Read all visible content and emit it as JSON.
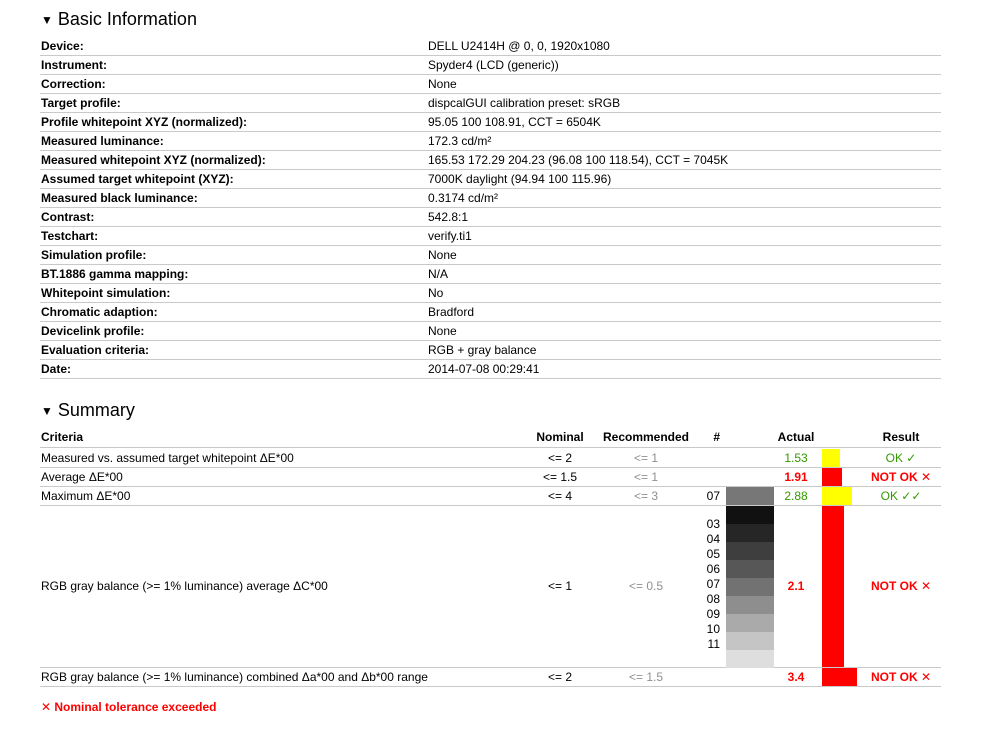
{
  "basic_info": {
    "heading": "Basic Information",
    "rows": [
      {
        "label": "Device:",
        "value": "DELL U2414H @ 0, 0, 1920x1080"
      },
      {
        "label": "Instrument:",
        "value": "Spyder4 (LCD (generic))"
      },
      {
        "label": "Correction:",
        "value": "None"
      },
      {
        "label": "Target profile:",
        "value": "dispcalGUI calibration preset: sRGB"
      },
      {
        "label": "Profile whitepoint XYZ (normalized):",
        "value": "95.05 100 108.91, CCT = 6504K"
      },
      {
        "label": "Measured luminance:",
        "value": "172.3 cd/m²"
      },
      {
        "label": "Measured whitepoint XYZ (normalized):",
        "value": "165.53 172.29 204.23 (96.08 100 118.54), CCT = 7045K"
      },
      {
        "label": "Assumed target whitepoint (XYZ):",
        "value": "7000K daylight (94.94 100 115.96)"
      },
      {
        "label": "Measured black luminance:",
        "value": "0.3174 cd/m²"
      },
      {
        "label": "Contrast:",
        "value": "542.8:1"
      },
      {
        "label": "Testchart:",
        "value": "verify.ti1"
      },
      {
        "label": "Simulation profile:",
        "value": "None"
      },
      {
        "label": "BT.1886 gamma mapping:",
        "value": "N/A"
      },
      {
        "label": "Whitepoint simulation:",
        "value": "No"
      },
      {
        "label": "Chromatic adaption:",
        "value": "Bradford"
      },
      {
        "label": "Devicelink profile:",
        "value": "None"
      },
      {
        "label": "Evaluation criteria:",
        "value": "RGB + gray balance"
      },
      {
        "label": "Date:",
        "value": "2014-07-08 00:29:41"
      }
    ]
  },
  "summary": {
    "heading": "Summary",
    "headers": {
      "criteria": "Criteria",
      "nominal": "Nominal",
      "recommended": "Recommended",
      "number": "#",
      "actual": "Actual",
      "result": "Result"
    },
    "rows": [
      {
        "criteria": "Measured vs. assumed target whitepoint ΔE*00",
        "nominal": "<= 2",
        "recommended": "<= 1",
        "number": "",
        "actual": "1.53",
        "result": "OK ✓",
        "bar_color": "#ffff00",
        "bar_fraction": 0.25
      },
      {
        "criteria": "Average ΔE*00",
        "nominal": "<= 1.5",
        "recommended": "<= 1",
        "number": "",
        "actual": "1.91",
        "result": "NOT OK ✕",
        "bar_color": "#ff0000",
        "bar_fraction": 0.28
      },
      {
        "criteria": "Maximum ΔE*00",
        "nominal": "<= 4",
        "recommended": "<= 3",
        "number": "07",
        "actual": "2.88",
        "result": "OK ✓✓",
        "bar_color": "#ffff00",
        "bar_fraction": 0.42
      },
      {
        "criteria": "RGB gray balance (>= 1% luminance) average ΔC*00",
        "nominal": "<= 1",
        "recommended": "<= 0.5",
        "numbers": [
          "03",
          "04",
          "05",
          "06",
          "07",
          "08",
          "09",
          "10",
          "11"
        ],
        "actual": "2.1",
        "result": "NOT OK ✕",
        "bar_color": "#ff0000",
        "bar_fraction": 0.3
      },
      {
        "criteria": "RGB gray balance (>= 1% luminance) combined Δa*00 and Δb*00 range",
        "nominal": "<= 2",
        "recommended": "<= 1.5",
        "number": "",
        "actual": "3.4",
        "result": "NOT OK ✕",
        "bar_color": "#ff0000",
        "bar_fraction": 0.48
      }
    ],
    "gray_swatches": [
      "#111111",
      "#262626",
      "#3e3e3e",
      "#575757",
      "#727272",
      "#8e8e8e",
      "#aaaaaa",
      "#c5c5c5",
      "#dedede"
    ],
    "max_swatch": "#777777",
    "footer": "✕ Nominal tolerance exceeded"
  },
  "colors": {
    "ok": "#339900",
    "bad": "#ff0000",
    "warn": "#ffff00",
    "muted": "#909090"
  }
}
